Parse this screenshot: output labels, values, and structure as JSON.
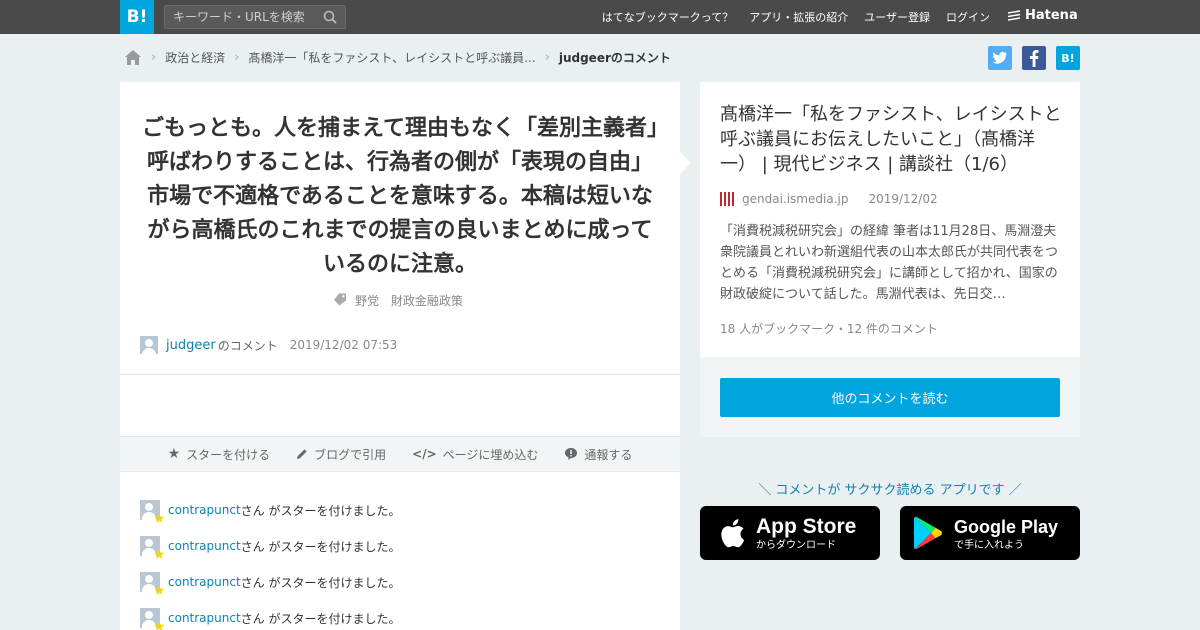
{
  "header": {
    "logo": "B!",
    "search_placeholder": "キーワード・URLを検索",
    "nav": [
      "はてなブックマークって？",
      "アプリ・拡張の紹介",
      "ユーザー登録",
      "ログイン"
    ],
    "brand": "Hatena"
  },
  "breadcrumb": {
    "items": [
      "政治と経済",
      "髙橋洋一「私をファシスト、レイシストと呼ぶ議員...",
      "judgeerのコメント"
    ]
  },
  "share": {
    "twitter": "t",
    "facebook": "f",
    "hatena": "B!"
  },
  "comment": {
    "text": "ごもっとも。人を捕まえて理由もなく「差別主義者」呼ばわりすることは、行為者の側が「表現の自由」市場で不適格であることを意味する。本稿は短いながら高橋氏のこれまでの提言の良いまとめに成っているのに注意。",
    "tags": [
      "野党",
      "財政金融政策"
    ],
    "user": "judgeer",
    "user_suffix": "のコメント",
    "datetime": "2019/12/02 07:53"
  },
  "actions": {
    "star": "スターを付ける",
    "blog": "ブログで引用",
    "embed": "ページに埋め込む",
    "report": "通報する"
  },
  "stars": [
    {
      "user": "contrapunct",
      "text": "さん がスターを付けました。"
    },
    {
      "user": "contrapunct",
      "text": "さん がスターを付けました。"
    },
    {
      "user": "contrapunct",
      "text": "さん がスターを付けました。"
    },
    {
      "user": "contrapunct",
      "text": "さん がスターを付けました。"
    }
  ],
  "article": {
    "title": "髙橋洋一「私をファシスト、レイシストと呼ぶ議員にお伝えしたいこと」（髙橋洋一） | 現代ビジネス | 講談社（1/6）",
    "domain": "gendai.ismedia.jp",
    "date": "2019/12/02",
    "description": "「消費税減税研究会」の経緯 筆者は11月28日、馬淵澄夫衆院議員とれいわ新選組代表の山本太郎氏が共同代表をつとめる「消費税減税研究会」に講師として招かれ、国家の財政破綻について話した。馬淵代表は、先日交…",
    "counts": "18 人がブックマーク・12 件のコメント",
    "more_button": "他のコメントを読む"
  },
  "promo": {
    "text": "＼ コメントが サクサク読める アプリです ／",
    "app_store": {
      "big": "App Store",
      "small": "からダウンロード"
    },
    "google_play": {
      "big": "Google Play",
      "small": "で手に入れよう"
    }
  },
  "colors": {
    "accent": "#00a4de",
    "link": "#0c83ad",
    "topbar": "#4a4a4a"
  }
}
